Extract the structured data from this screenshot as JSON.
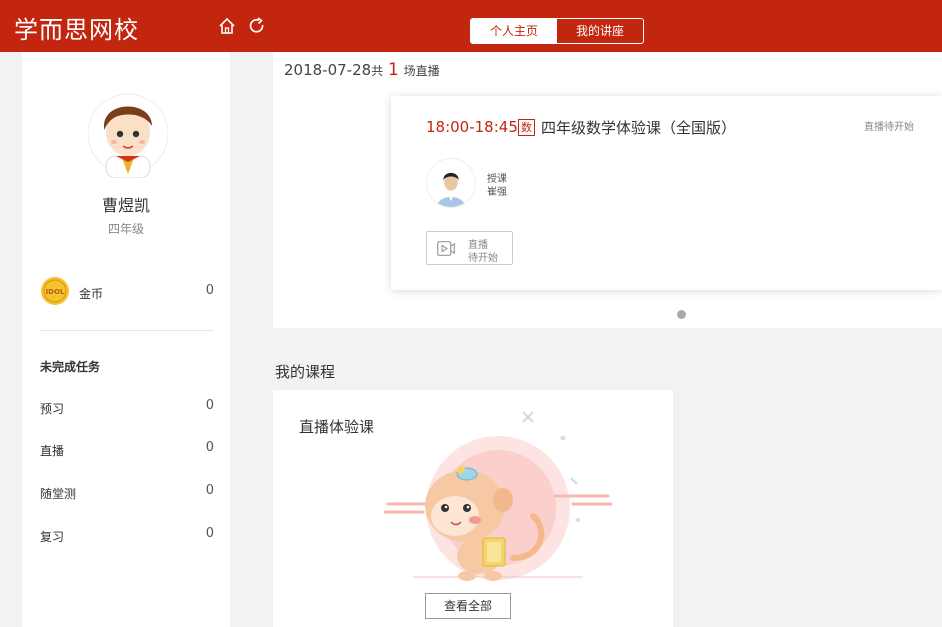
{
  "app": {
    "logo_text": "学而思网校"
  },
  "header": {
    "tabs": [
      {
        "label": "个人主页",
        "active": true
      },
      {
        "label": "我的讲座",
        "active": false
      }
    ]
  },
  "user": {
    "name": "曹煜凯",
    "grade": "四年级",
    "coin_label": "金币",
    "coin_value": "0",
    "coin_icon_text": "IDOL"
  },
  "tasks": {
    "title": "未完成任务",
    "items": [
      {
        "label": "预习",
        "value": "0"
      },
      {
        "label": "直播",
        "value": "0"
      },
      {
        "label": "随堂测",
        "value": "0"
      },
      {
        "label": "复习",
        "value": "0"
      }
    ]
  },
  "live": {
    "date": "2018-07-28",
    "count_prefix": "共",
    "count": "1",
    "count_suffix": "场直播",
    "card": {
      "time": "18:00-18:45",
      "subject_badge": "数",
      "title": "四年级数学体验课（全国版）",
      "status": "直播待开始",
      "teacher_role": "授课",
      "teacher_name": "崔强",
      "button_line1": "直播",
      "button_line2": "待开始"
    }
  },
  "courses": {
    "section_title": "我的课程",
    "card_title": "直播体验课",
    "view_all": "查看全部"
  },
  "colors": {
    "brand": "#c3260e",
    "background": "#f2f2f2"
  }
}
